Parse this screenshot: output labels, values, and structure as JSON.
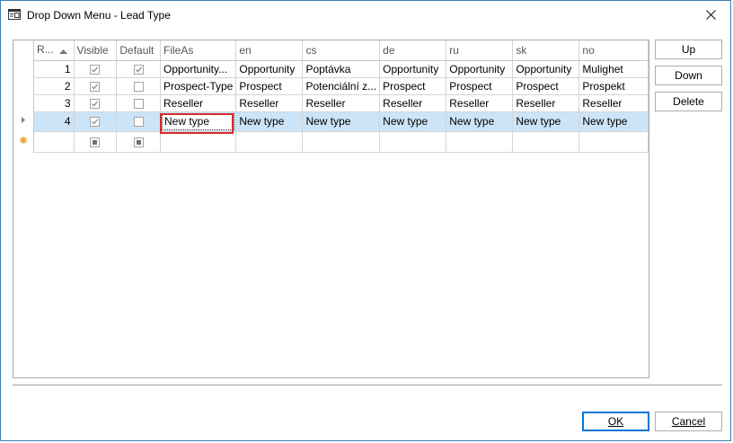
{
  "window": {
    "title": "Drop Down Menu - Lead Type"
  },
  "grid": {
    "columns": [
      "R...",
      "Visible",
      "Default",
      "FileAs",
      "en",
      "cs",
      "de",
      "ru",
      "sk",
      "no"
    ],
    "sort_column": "R...",
    "rows": [
      {
        "row": "1",
        "visible": true,
        "default": true,
        "fileas": "Opportunity...",
        "en": "Opportunity",
        "cs": "Poptávka",
        "de": "Opportunity",
        "ru": "Opportunity",
        "sk": "Opportunity",
        "no": "Mulighet"
      },
      {
        "row": "2",
        "visible": true,
        "default": false,
        "fileas": "Prospect-Type",
        "en": "Prospect",
        "cs": "Potenciální z...",
        "de": "Prospect",
        "ru": "Prospect",
        "sk": "Prospect",
        "no": "Prospekt"
      },
      {
        "row": "3",
        "visible": true,
        "default": false,
        "fileas": "Reseller",
        "en": "Reseller",
        "cs": "Reseller",
        "de": "Reseller",
        "ru": "Reseller",
        "sk": "Reseller",
        "no": "Reseller"
      },
      {
        "row": "4",
        "visible": true,
        "default": false,
        "fileas": "New type",
        "en": "New type",
        "cs": "New type",
        "de": "New type",
        "ru": "New type",
        "sk": "New type",
        "no": "New type"
      }
    ],
    "selected_row": "4",
    "editing_cell": "FileAs"
  },
  "side_buttons": {
    "up": "Up",
    "down": "Down",
    "delete": "Delete"
  },
  "footer": {
    "ok": "OK",
    "cancel": "Cancel"
  },
  "colors": {
    "selection": "#cce4f7",
    "focus_frame": "#d42c2c",
    "accent": "#0078d7"
  }
}
